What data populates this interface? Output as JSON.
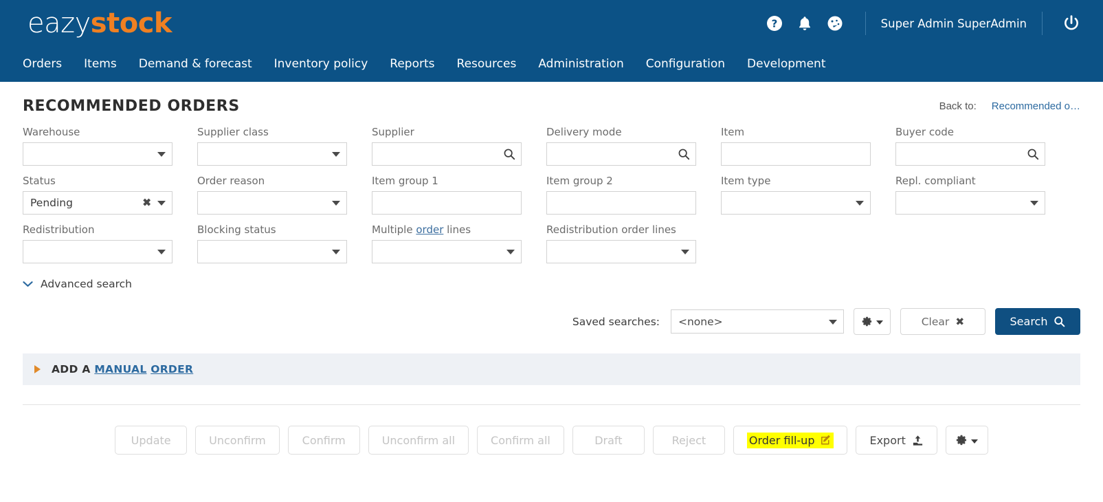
{
  "brand": {
    "logo_part1": "eazy",
    "logo_part2": "stock",
    "blue": "#0c5286",
    "orange": "#ef8022",
    "highlight": "#ffff00"
  },
  "topbar": {
    "icons": [
      {
        "name": "help-icon",
        "label": "Help"
      },
      {
        "name": "notifications-bell-icon",
        "label": "Notifications"
      },
      {
        "name": "dashboard-gauge-icon",
        "label": "Dashboard"
      }
    ],
    "username": "Super Admin SuperAdmin",
    "logout_label": "Log out"
  },
  "nav": {
    "items": [
      {
        "label": "Orders"
      },
      {
        "label": "Items"
      },
      {
        "label": "Demand & forecast"
      },
      {
        "label": "Inventory policy"
      },
      {
        "label": "Reports"
      },
      {
        "label": "Resources"
      },
      {
        "label": "Administration"
      },
      {
        "label": "Configuration"
      },
      {
        "label": "Development"
      }
    ]
  },
  "page": {
    "title": "RECOMMENDED ORDERS",
    "back_to_label": "Back to:",
    "back_to_link": "Recommended o…"
  },
  "filters": {
    "row1": [
      {
        "label": "Warehouse",
        "type": "select",
        "value": ""
      },
      {
        "label": "Supplier class",
        "type": "select",
        "value": ""
      },
      {
        "label": "Supplier",
        "type": "search",
        "value": ""
      },
      {
        "label": "Delivery mode",
        "type": "search",
        "value": ""
      },
      {
        "label": "Item",
        "type": "text",
        "value": ""
      },
      {
        "label": "Buyer code",
        "type": "search",
        "value": ""
      }
    ],
    "row2": [
      {
        "label": "Status",
        "type": "select-clearable",
        "value": "Pending"
      },
      {
        "label": "Order reason",
        "type": "select",
        "value": ""
      },
      {
        "label": "Item group 1",
        "type": "text",
        "value": ""
      },
      {
        "label": "Item group 2",
        "type": "text",
        "value": ""
      },
      {
        "label": "Item type",
        "type": "select",
        "value": ""
      },
      {
        "label": "Repl. compliant",
        "type": "select",
        "value": ""
      }
    ],
    "row3": [
      {
        "label": "Redistribution",
        "type": "select",
        "value": ""
      },
      {
        "label": "Blocking status",
        "type": "select",
        "value": ""
      },
      {
        "label_pre": "Multiple ",
        "label_link": "order",
        "label_post": " lines",
        "type": "select",
        "value": ""
      },
      {
        "label": "Redistribution order lines",
        "type": "select",
        "value": ""
      }
    ],
    "advanced_search_label": "Advanced search"
  },
  "saved_search": {
    "label": "Saved searches:",
    "selected": "<none>",
    "gear_label": "Saved search options",
    "clear_label": "Clear",
    "clear_icon": "✖",
    "search_label": "Search"
  },
  "manual_order": {
    "prefix": "ADD A ",
    "link1": "MANUAL",
    "separator": " ",
    "link2": "ORDER"
  },
  "actions": [
    {
      "label": "Update",
      "enabled": false
    },
    {
      "label": "Unconfirm",
      "enabled": false
    },
    {
      "label": "Confirm",
      "enabled": false
    },
    {
      "label": "Unconfirm all",
      "enabled": false
    },
    {
      "label": "Confirm all",
      "enabled": false
    },
    {
      "label": "Draft",
      "enabled": false
    },
    {
      "label": "Reject",
      "enabled": false
    },
    {
      "label": "Order fill-up",
      "enabled": true,
      "highlighted": true,
      "icon": "edit-square-icon"
    },
    {
      "label": "Export",
      "enabled": true,
      "icon": "upload-icon"
    },
    {
      "label": "",
      "enabled": true,
      "icon": "gear-icon",
      "is_gear": true
    }
  ]
}
